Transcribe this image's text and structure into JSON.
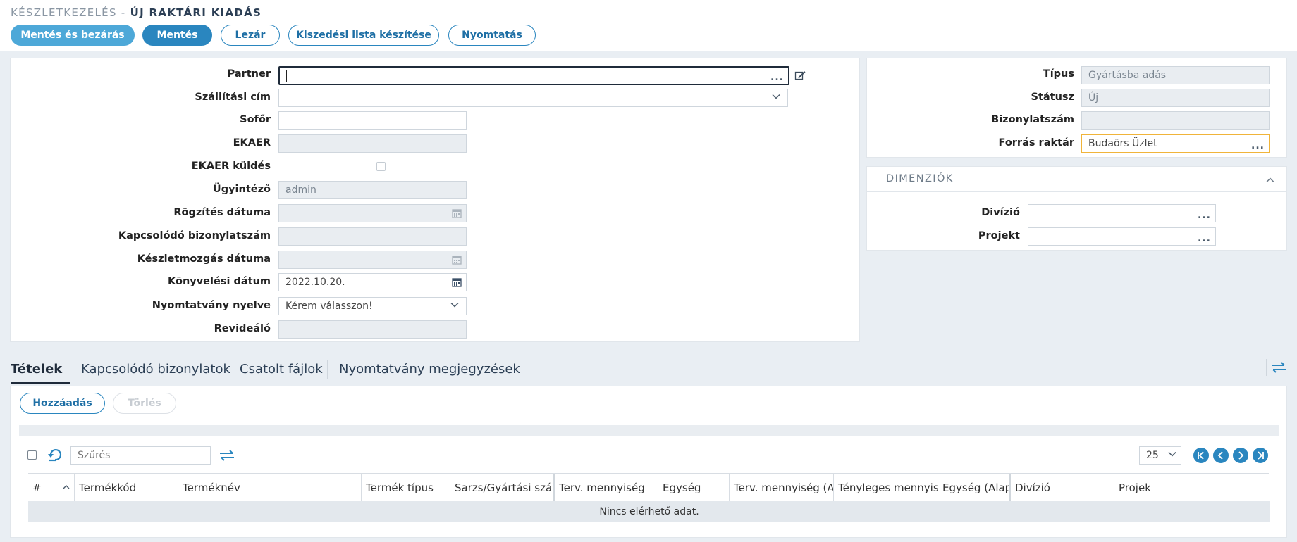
{
  "breadcrumb": {
    "section": "KÉSZLETKEZELÉS -",
    "current": "ÚJ RAKTÁRI KIADÁS"
  },
  "toolbar": {
    "save_close": "Mentés és bezárás",
    "save": "Mentés",
    "close": "Lezár",
    "picking_list": "Kiszedési lista készítése",
    "print": "Nyomtatás"
  },
  "form_left": {
    "partner": {
      "label": "Partner",
      "value": ""
    },
    "shipping_address": {
      "label": "Szállítási cím",
      "value": ""
    },
    "driver": {
      "label": "Sofőr",
      "value": ""
    },
    "ekaer": {
      "label": "EKAER",
      "value": ""
    },
    "ekaer_send": {
      "label": "EKAER küldés"
    },
    "agent": {
      "label": "Ügyintéző",
      "value": "admin"
    },
    "record_date": {
      "label": "Rögzítés dátuma",
      "value": ""
    },
    "related_doc_no": {
      "label": "Kapcsolódó bizonylatszám",
      "value": ""
    },
    "movement_date": {
      "label": "Készletmozgás dátuma",
      "value": ""
    },
    "accounting_date": {
      "label": "Könyvelési dátum",
      "value": "2022.10.20."
    },
    "print_language": {
      "label": "Nyomtatvány nyelve",
      "value": "Kérem válasszon!"
    },
    "reviewer": {
      "label": "Revideáló",
      "value": ""
    }
  },
  "form_right": {
    "type": {
      "label": "Típus",
      "value": "Gyártásba adás"
    },
    "status": {
      "label": "Státusz",
      "value": "Új"
    },
    "doc_no": {
      "label": "Bizonylatszám",
      "value": ""
    },
    "source_warehouse": {
      "label": "Forrás raktár",
      "value": "Budaörs Üzlet"
    }
  },
  "dimensions": {
    "title": "DIMENZIÓK",
    "division": {
      "label": "Divízió",
      "value": ""
    },
    "project": {
      "label": "Projekt",
      "value": ""
    }
  },
  "tabs": [
    "Tételek",
    "Kapcsolódó bizonylatok",
    "Csatolt fájlok",
    "Nyomtatvány megjegyzések"
  ],
  "items": {
    "add": "Hozzáadás",
    "delete": "Törlés",
    "filter_placeholder": "Szűrés",
    "page_size": "25",
    "columns": [
      "#",
      "Termékkód",
      "Terméknév",
      "Termék típus",
      "Sarzs/Gyártási szám",
      "Terv. mennyiség",
      "Egység",
      "Terv. mennyiség (Alap)",
      "Tényleges mennyiség",
      "Egység (Alap)",
      "Divízió",
      "Projekt"
    ],
    "no_data": "Nincs elérhető adat."
  },
  "colors": {
    "primary": "#2a86bf",
    "primary_light": "#4da8d8",
    "highlight_border": "#f0b43a"
  }
}
